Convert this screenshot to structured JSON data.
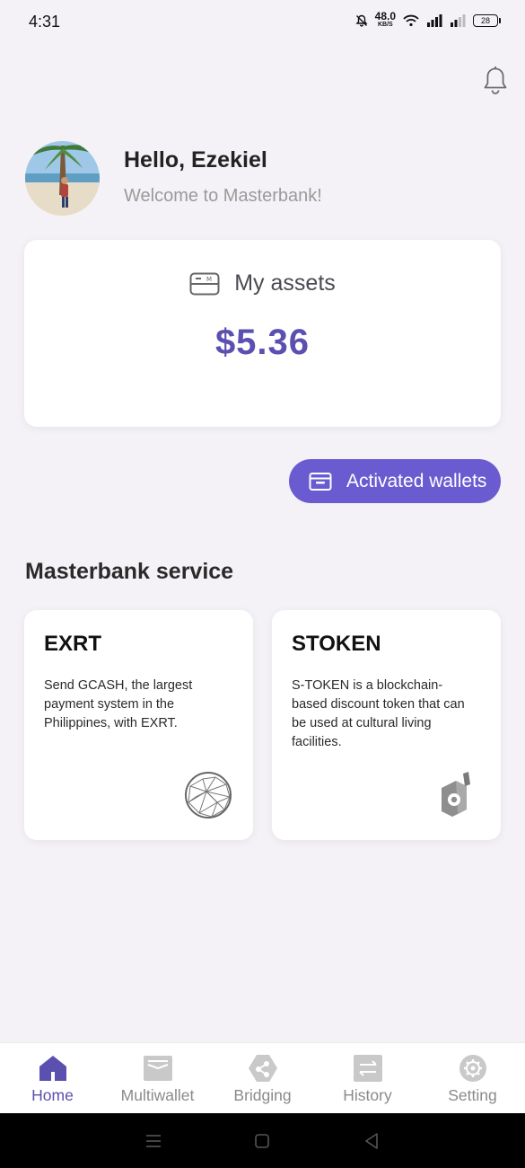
{
  "status_bar": {
    "time": "4:31",
    "net_speed": "48.0",
    "net_unit": "KB/S",
    "battery": "28"
  },
  "header": {
    "greeting": "Hello, Ezekiel",
    "welcome": "Welcome to Masterbank!",
    "bell_icon": "bell-icon"
  },
  "assets": {
    "title": "My assets",
    "value": "$5.36",
    "icon": "card-icon"
  },
  "wallets_button": {
    "label": "Activated wallets",
    "icon": "wallet-icon"
  },
  "services": {
    "section_title": "Masterbank service",
    "items": [
      {
        "name": "EXRT",
        "description": "Send GCASH, the largest payment system in the Philippines, with EXRT.",
        "icon": "network-globe-icon"
      },
      {
        "name": "STOKEN",
        "description": "S-TOKEN is a blockchain-based discount token that can be used at cultural living facilities.",
        "icon": "stoken-logo-icon"
      }
    ]
  },
  "bottom_nav": {
    "items": [
      {
        "label": "Home",
        "icon": "home-icon",
        "active": true
      },
      {
        "label": "Multiwallet",
        "icon": "multiwallet-icon",
        "active": false
      },
      {
        "label": "Bridging",
        "icon": "bridging-icon",
        "active": false
      },
      {
        "label": "History",
        "icon": "history-icon",
        "active": false
      },
      {
        "label": "Setting",
        "icon": "gear-icon",
        "active": false
      }
    ]
  },
  "colors": {
    "accent": "#6b5bd0",
    "asset_value": "#5b4fb0",
    "background": "#f4f2f6"
  }
}
